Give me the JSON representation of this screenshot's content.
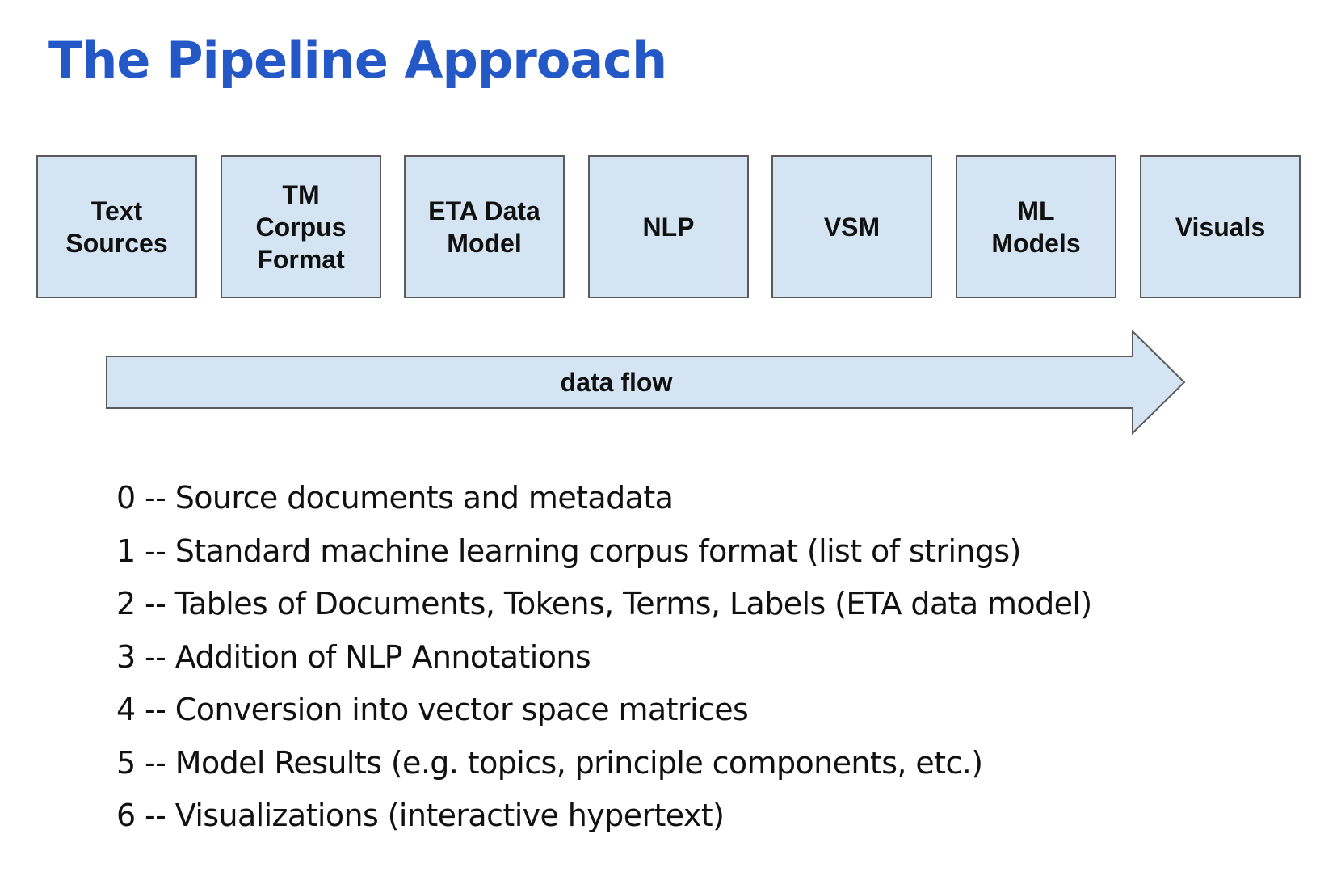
{
  "title": "The Pipeline Approach",
  "stages": [
    {
      "label": "Text\nSources"
    },
    {
      "label": "TM\nCorpus\nFormat"
    },
    {
      "label": "ETA Data\nModel"
    },
    {
      "label": "NLP"
    },
    {
      "label": "VSM"
    },
    {
      "label": "ML\nModels"
    },
    {
      "label": "Visuals"
    }
  ],
  "flow": {
    "label": "data flow"
  },
  "notes": [
    "0 -- Source documents and metadata",
    "1 -- Standard machine learning corpus format (list of strings)",
    "2 -- Tables of Documents, Tokens, Terms, Labels (ETA data model)",
    "3 -- Addition of NLP Annotations",
    "4 -- Conversion into vector space matrices",
    "5 -- Model Results (e.g. topics, principle components, etc.)",
    "6 -- Visualizations (interactive hypertext)"
  ],
  "colors": {
    "title": "#2458c6",
    "box_fill": "#d5e4f2",
    "box_border": "#5a5a5a",
    "text": "#111111"
  }
}
